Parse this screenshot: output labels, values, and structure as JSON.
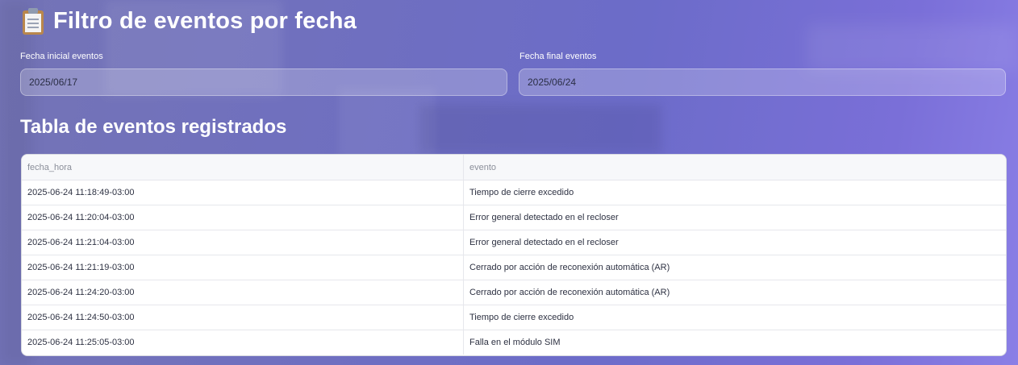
{
  "page": {
    "title": "Filtro de eventos por fecha",
    "title_icon": "clipboard-icon"
  },
  "filters": {
    "start": {
      "label": "Fecha inicial eventos",
      "value": "2025/06/17"
    },
    "end": {
      "label": "Fecha final eventos",
      "value": "2025/06/24"
    }
  },
  "events_table": {
    "title": "Tabla de eventos registrados",
    "columns": [
      "fecha_hora",
      "evento"
    ],
    "rows": [
      [
        "2025-06-24 11:18:49-03:00",
        "Tiempo de cierre excedido"
      ],
      [
        "2025-06-24 11:20:04-03:00",
        "Error general detectado en el recloser"
      ],
      [
        "2025-06-24 11:21:04-03:00",
        "Error general detectado en el recloser"
      ],
      [
        "2025-06-24 11:21:19-03:00",
        "Cerrado por acción de reconexión automática (AR)"
      ],
      [
        "2025-06-24 11:24:20-03:00",
        "Cerrado por acción de reconexión automática (AR)"
      ],
      [
        "2025-06-24 11:24:50-03:00",
        "Tiempo de cierre excedido"
      ],
      [
        "2025-06-24 11:25:05-03:00",
        "Falla en el módulo SIM"
      ]
    ]
  },
  "colors": {
    "background_accent": "#6f6fc0",
    "text_primary": "#ffffff",
    "table_header_bg": "#f7f8fa"
  }
}
